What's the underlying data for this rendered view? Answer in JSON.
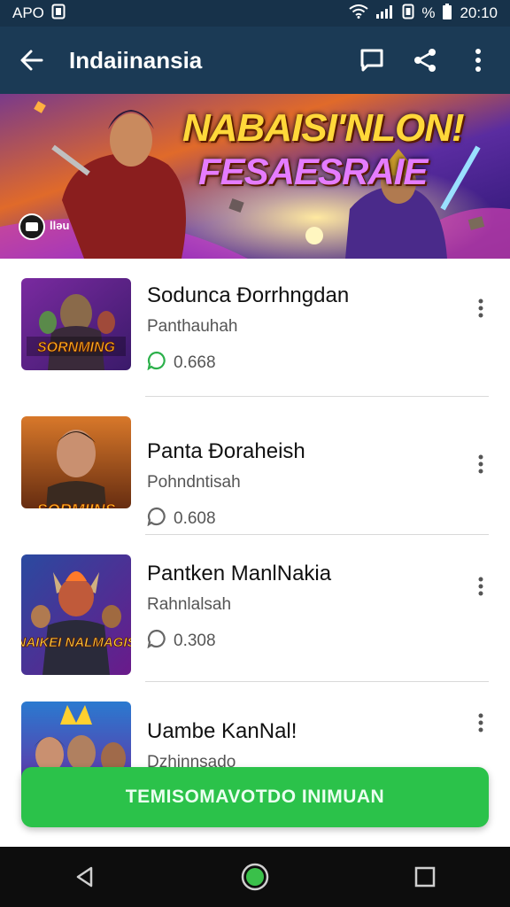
{
  "status_bar": {
    "left_text": "APO",
    "battery_text": "%",
    "time": "20:10"
  },
  "app_bar": {
    "title": "Indaiinansia"
  },
  "banner": {
    "title_line1": "NABAISI'NLON!",
    "title_line2": "FESAESRAIE",
    "badge_text": "lləu"
  },
  "items": [
    {
      "name": "Sodunca Đorrhngdan",
      "subtitle": "Panthauhah",
      "count": "0.668",
      "thumb_text": "SORNMING",
      "count_icon_color": "#2bb04a"
    },
    {
      "name": "Panta Đoraheish",
      "subtitle": "Pohndntisah",
      "count": "0.608",
      "thumb_text": "SORMIINS",
      "count_icon_color": "#666666"
    },
    {
      "name": "Pantken ManlNakia",
      "subtitle": "Rahnlalsah",
      "count": "0.308",
      "thumb_text": "NAIKEI NALMAGIS",
      "count_icon_color": "#666666"
    },
    {
      "name": "Uambe KanNal!",
      "subtitle": "Dzhinnsado",
      "count": "",
      "thumb_text": "",
      "count_icon_color": "#666666"
    }
  ],
  "cta": {
    "label": "TEMISOMAVOTDO INIMUAN"
  },
  "colors": {
    "app_bar": "#1b3a55",
    "accent_green": "#2bc24a"
  }
}
